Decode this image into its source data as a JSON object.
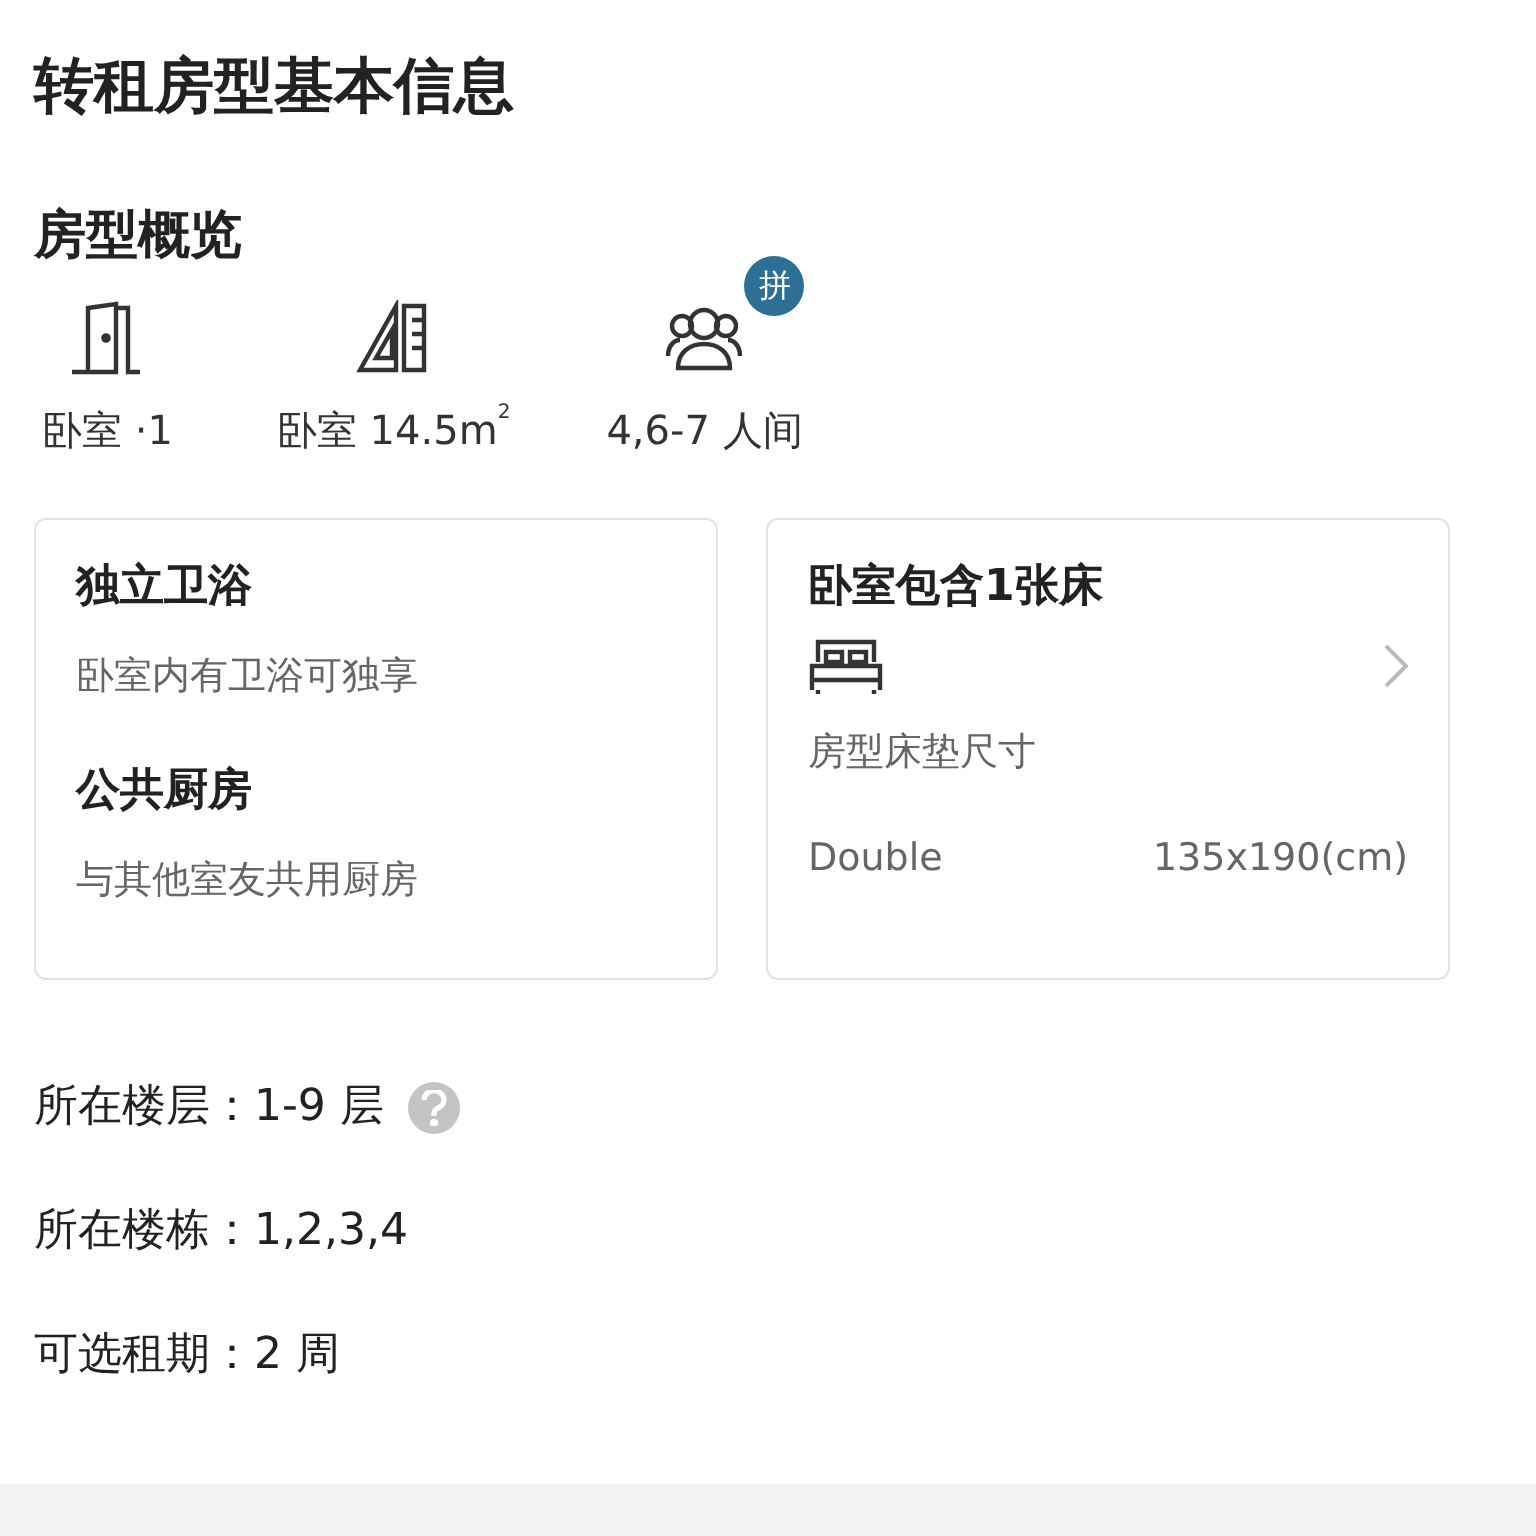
{
  "title": "转租房型基本信息",
  "overview": {
    "heading": "房型概览",
    "items": [
      {
        "kind": "door",
        "label": "卧室 ·1"
      },
      {
        "kind": "ruler",
        "label": "卧室 14.5m$^{2}$"
      },
      {
        "kind": "people",
        "label": "4,6-7 人间",
        "badge": "拼"
      }
    ]
  },
  "facilities": [
    {
      "title": "独立卫浴",
      "description": "卧室内有卫浴可独享"
    },
    {
      "title": "公共厨房",
      "description": "与其他室友共用厨房"
    }
  ],
  "bed_card": {
    "title": "卧室包含1张床",
    "subtitle": "房型床垫尺寸",
    "bed_type": "Double",
    "size": "135x190(cm)"
  },
  "details": [
    {
      "label": "所在楼层：",
      "value": "1-9 层",
      "help": true
    },
    {
      "label": "所在楼栋：",
      "value": "1,2,3,4",
      "help": false
    },
    {
      "label": "可选租期：",
      "value": "2 周",
      "help": false
    }
  ]
}
